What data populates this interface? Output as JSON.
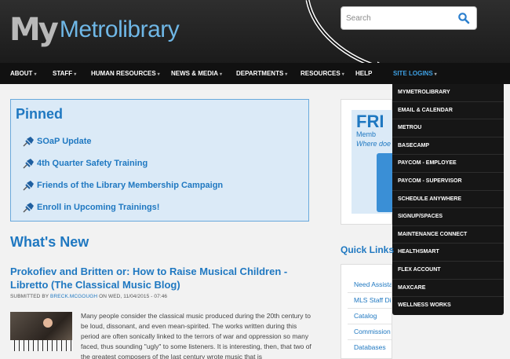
{
  "header": {
    "logo_my": "My",
    "logo_text": "Metrolibrary",
    "search_placeholder": "Search"
  },
  "nav": {
    "items": [
      {
        "label": "ABOUT"
      },
      {
        "label": "STAFF"
      },
      {
        "label": "HUMAN RESOURCES"
      },
      {
        "label": "NEWS & MEDIA"
      },
      {
        "label": "DEPARTMENTS"
      },
      {
        "label": "RESOURCES"
      },
      {
        "label": "HELP"
      },
      {
        "label": "SITE LOGINS"
      }
    ],
    "active": "SITE LOGINS"
  },
  "site_logins_menu": [
    "MYMETROLIBRARY",
    "EMAIL & CALENDAR",
    "METROU",
    "BASECAMP",
    "PAYCOM - EMPLOYEE",
    "PAYCOM - SUPERVISOR",
    "SCHEDULE ANYWHERE",
    "SIGNUP/SPACES",
    "MAINTENANCE CONNECT",
    "HEALTHSMART",
    "FLEX ACCOUNT",
    "MAXCARE",
    "WELLNESS WORKS"
  ],
  "pinned": {
    "title": "Pinned",
    "items": [
      "SOaP Update",
      "4th Quarter Safety Training",
      "Friends of the Library Membership Campaign",
      "Enroll in Upcoming Trainings!"
    ]
  },
  "whats_new": {
    "title": "What's New",
    "post": {
      "title": "Prokofiev and Britten or: How to Raise Musical Children - Libretto (The Classical Music Blog)",
      "submitted_prefix": "SUBMITTED BY",
      "author": "BRECK.MCGOUGH",
      "submitted_suffix": "ON WED, 11/04/2015 - 07:46",
      "body": "Many people consider the classical music produced during the 20th century to be loud, dissonant, and even mean-spirited. The works written during this period are often sonically linked to the terrors of war and oppression so many faced, thus sounding \"ugly\" to some listeners. It is interesting, then, that two of the greatest composers of the last century wrote music that is"
    }
  },
  "promo": {
    "big": "FRI",
    "sub": "Memb",
    "question": "Where doe"
  },
  "quick_links": {
    "title": "Quick Links",
    "items": [
      "Need Assista",
      "MLS Staff Dir",
      "Catalog",
      "Commission Packets",
      "Databases"
    ]
  },
  "colors": {
    "accent": "#1f78c1",
    "nav_active": "#3ea0e3",
    "pinned_bg": "#dbeaf7",
    "header_bg": "#222222"
  },
  "icons": [
    "search-icon",
    "pin-icon",
    "caret-down-icon",
    "arrow-annotation"
  ]
}
